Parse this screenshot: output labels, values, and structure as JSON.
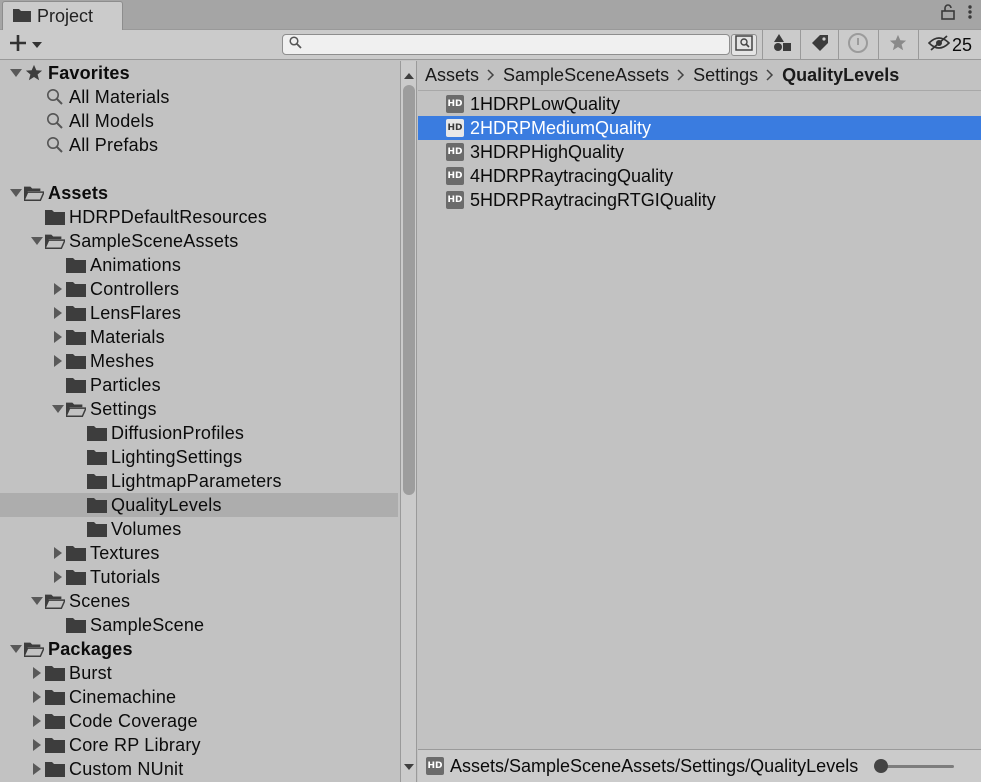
{
  "window": {
    "tab_label": "Project"
  },
  "toolbar": {
    "search_placeholder": "",
    "hidden_count": "25"
  },
  "tree": {
    "rows": [
      {
        "label": "Favorites",
        "indent": 0,
        "arrow": "down",
        "icon": "star-icon",
        "bold": true
      },
      {
        "label": "All Materials",
        "indent": 1,
        "arrow": "none",
        "icon": "search-icon"
      },
      {
        "label": "All Models",
        "indent": 1,
        "arrow": "none",
        "icon": "search-icon"
      },
      {
        "label": "All Prefabs",
        "indent": 1,
        "arrow": "none",
        "icon": "search-icon"
      },
      {
        "label": "",
        "indent": 0,
        "arrow": "none",
        "icon": "none"
      },
      {
        "label": "Assets",
        "indent": 0,
        "arrow": "down",
        "icon": "open-folder-icon",
        "bold": true
      },
      {
        "label": "HDRPDefaultResources",
        "indent": 1,
        "arrow": "none",
        "icon": "folder-icon"
      },
      {
        "label": "SampleSceneAssets",
        "indent": 1,
        "arrow": "down",
        "icon": "open-folder-icon"
      },
      {
        "label": "Animations",
        "indent": 2,
        "arrow": "none",
        "icon": "folder-icon"
      },
      {
        "label": "Controllers",
        "indent": 2,
        "arrow": "right",
        "icon": "folder-icon"
      },
      {
        "label": "LensFlares",
        "indent": 2,
        "arrow": "right",
        "icon": "folder-icon"
      },
      {
        "label": "Materials",
        "indent": 2,
        "arrow": "right",
        "icon": "folder-icon"
      },
      {
        "label": "Meshes",
        "indent": 2,
        "arrow": "right",
        "icon": "folder-icon"
      },
      {
        "label": "Particles",
        "indent": 2,
        "arrow": "none",
        "icon": "folder-icon"
      },
      {
        "label": "Settings",
        "indent": 2,
        "arrow": "down",
        "icon": "open-folder-icon"
      },
      {
        "label": "DiffusionProfiles",
        "indent": 3,
        "arrow": "none",
        "icon": "folder-icon"
      },
      {
        "label": "LightingSettings",
        "indent": 3,
        "arrow": "none",
        "icon": "folder-icon"
      },
      {
        "label": "LightmapParameters",
        "indent": 3,
        "arrow": "none",
        "icon": "folder-icon"
      },
      {
        "label": "QualityLevels",
        "indent": 3,
        "arrow": "none",
        "icon": "folder-icon",
        "selected": true
      },
      {
        "label": "Volumes",
        "indent": 3,
        "arrow": "none",
        "icon": "folder-icon"
      },
      {
        "label": "Textures",
        "indent": 2,
        "arrow": "right",
        "icon": "folder-icon"
      },
      {
        "label": "Tutorials",
        "indent": 2,
        "arrow": "right",
        "icon": "folder-icon"
      },
      {
        "label": "Scenes",
        "indent": 1,
        "arrow": "down",
        "icon": "open-folder-icon"
      },
      {
        "label": "SampleScene",
        "indent": 2,
        "arrow": "none",
        "icon": "folder-icon"
      },
      {
        "label": "Packages",
        "indent": 0,
        "arrow": "down",
        "icon": "open-folder-icon",
        "bold": true
      },
      {
        "label": "Burst",
        "indent": 1,
        "arrow": "right",
        "icon": "folder-icon"
      },
      {
        "label": "Cinemachine",
        "indent": 1,
        "arrow": "right",
        "icon": "folder-icon"
      },
      {
        "label": "Code Coverage",
        "indent": 1,
        "arrow": "right",
        "icon": "folder-icon"
      },
      {
        "label": "Core RP Library",
        "indent": 1,
        "arrow": "right",
        "icon": "folder-icon"
      },
      {
        "label": "Custom NUnit",
        "indent": 1,
        "arrow": "right",
        "icon": "folder-icon"
      }
    ]
  },
  "breadcrumb": [
    "Assets",
    "SampleSceneAssets",
    "Settings",
    "QualityLevels"
  ],
  "assets": [
    {
      "label": "1HDRPLowQuality",
      "icon_text": "HD"
    },
    {
      "label": "2HDRPMediumQuality",
      "icon_text": "HD",
      "selected": true
    },
    {
      "label": "3HDRPHighQuality",
      "icon_text": "HD"
    },
    {
      "label": "4HDRPRaytracingQuality",
      "icon_text": "HD"
    },
    {
      "label": "5HDRPRaytracingRTGIQuality",
      "icon_text": "HD"
    }
  ],
  "footer": {
    "path": "Assets/SampleSceneAssets/Settings/QualityLevels",
    "icon_text": "HD",
    "zoom": 0.0
  },
  "colors": {
    "selection_blue": "#3a7ce0",
    "tree_selection": "#adadad"
  }
}
